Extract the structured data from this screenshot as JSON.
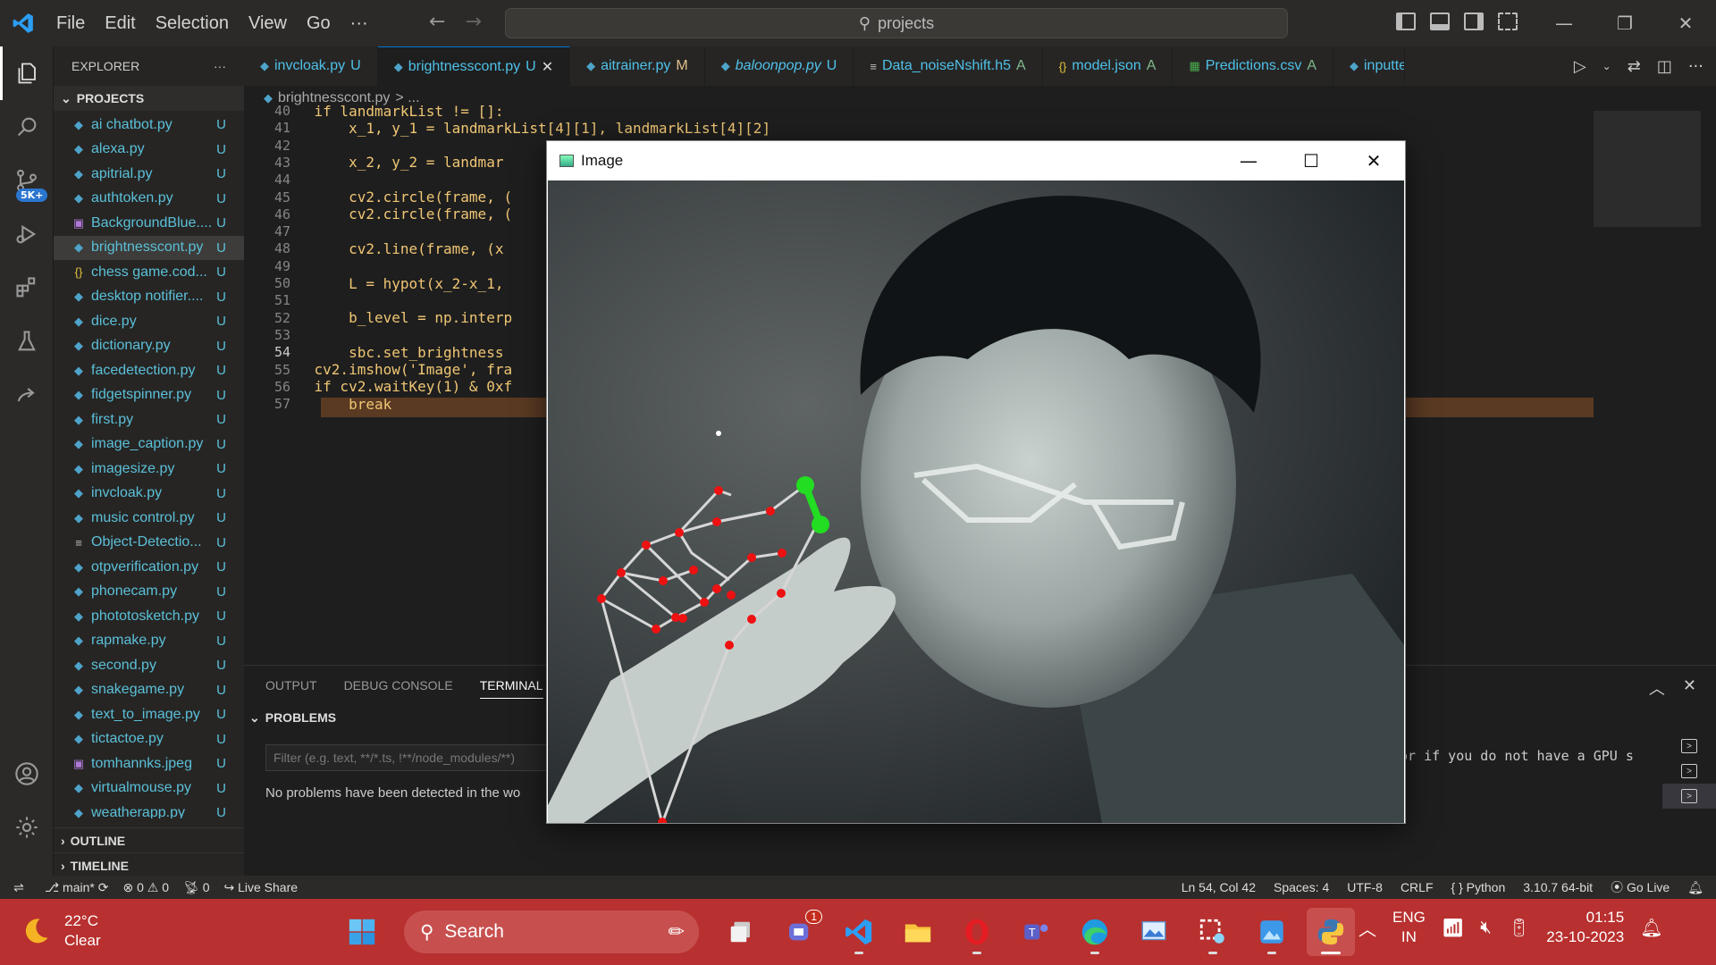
{
  "menu": [
    "File",
    "Edit",
    "Selection",
    "View",
    "Go",
    "···"
  ],
  "command_center": {
    "text": "projects"
  },
  "explorer": {
    "title": "EXPLORER",
    "more": "···",
    "section": "PROJECTS",
    "files": [
      {
        "name": "ai chatbot.py",
        "status": "U",
        "icon": "python-icon"
      },
      {
        "name": "alexa.py",
        "status": "U",
        "icon": "python-icon"
      },
      {
        "name": "apitrial.py",
        "status": "U",
        "icon": "python-icon"
      },
      {
        "name": "authtoken.py",
        "status": "U",
        "icon": "python-icon"
      },
      {
        "name": "BackgroundBlue....",
        "status": "U",
        "icon": "image-icon"
      },
      {
        "name": "brightnesscont.py",
        "status": "U",
        "icon": "python-icon",
        "selected": true
      },
      {
        "name": "chess game.cod...",
        "status": "U",
        "icon": "json-icon"
      },
      {
        "name": "desktop notifier....",
        "status": "U",
        "icon": "python-icon"
      },
      {
        "name": "dice.py",
        "status": "U",
        "icon": "python-icon"
      },
      {
        "name": "dictionary.py",
        "status": "U",
        "icon": "python-icon"
      },
      {
        "name": "facedetection.py",
        "status": "U",
        "icon": "python-icon"
      },
      {
        "name": "fidgetspinner.py",
        "status": "U",
        "icon": "python-icon"
      },
      {
        "name": "first.py",
        "status": "U",
        "icon": "python-icon"
      },
      {
        "name": "image_caption.py",
        "status": "U",
        "icon": "python-icon"
      },
      {
        "name": "imagesize.py",
        "status": "U",
        "icon": "python-icon"
      },
      {
        "name": "invcloak.py",
        "status": "U",
        "icon": "python-icon"
      },
      {
        "name": "music control.py",
        "status": "U",
        "icon": "python-icon"
      },
      {
        "name": "Object-Detectio...",
        "status": "U",
        "icon": "text-icon"
      },
      {
        "name": "otpverification.py",
        "status": "U",
        "icon": "python-icon"
      },
      {
        "name": "phonecam.py",
        "status": "U",
        "icon": "python-icon"
      },
      {
        "name": "phototosketch.py",
        "status": "U",
        "icon": "python-icon"
      },
      {
        "name": "rapmake.py",
        "status": "U",
        "icon": "python-icon"
      },
      {
        "name": "second.py",
        "status": "U",
        "icon": "python-icon"
      },
      {
        "name": "snakegame.py",
        "status": "U",
        "icon": "python-icon"
      },
      {
        "name": "text_to_image.py",
        "status": "U",
        "icon": "python-icon"
      },
      {
        "name": "tictactoe.py",
        "status": "U",
        "icon": "python-icon"
      },
      {
        "name": "tomhannks.jpeg",
        "status": "U",
        "icon": "image-icon"
      },
      {
        "name": "virtualmouse.py",
        "status": "U",
        "icon": "python-icon"
      },
      {
        "name": "weatherapp.py",
        "status": "U",
        "icon": "python-icon"
      }
    ],
    "outline": "OUTLINE",
    "timeline": "TIMELINE"
  },
  "tabs": [
    {
      "name": "invcloak.py",
      "status": "U",
      "icon": "python-icon"
    },
    {
      "name": "brightnesscont.py",
      "status": "U",
      "icon": "python-icon",
      "active": true
    },
    {
      "name": "aitrainer.py",
      "status": "M",
      "icon": "python-icon"
    },
    {
      "name": "baloonpop.py",
      "status": "U",
      "icon": "python-icon",
      "italic": true
    },
    {
      "name": "Data_noiseNshift.h5",
      "status": "A",
      "icon": "text-icon"
    },
    {
      "name": "model.json",
      "status": "A",
      "icon": "json-icon"
    },
    {
      "name": "Predictions.csv",
      "status": "A",
      "icon": "csv-icon"
    },
    {
      "name": "inputtе",
      "status": "",
      "icon": "python-icon"
    }
  ],
  "breadcrumb": {
    "file": "brightnesscont.py",
    "sep": "> ..."
  },
  "code_lines": [
    {
      "n": "40",
      "text": "    if landmarkList != []:"
    },
    {
      "n": "41",
      "text": "        x_1, y_1 = landmarkList[4][1], landmarkList[4][2]"
    },
    {
      "n": "42",
      "text": ""
    },
    {
      "n": "43",
      "text": "        x_2, y_2 = landmar"
    },
    {
      "n": "44",
      "text": ""
    },
    {
      "n": "45",
      "text": "        cv2.circle(frame, ("
    },
    {
      "n": "46",
      "text": "        cv2.circle(frame, ("
    },
    {
      "n": "47",
      "text": ""
    },
    {
      "n": "48",
      "text": "        cv2.line(frame, (x"
    },
    {
      "n": "49",
      "text": ""
    },
    {
      "n": "50",
      "text": "        L = hypot(x_2-x_1,"
    },
    {
      "n": "51",
      "text": ""
    },
    {
      "n": "52",
      "text": "        b_level = np.interp"
    },
    {
      "n": "53",
      "text": ""
    },
    {
      "n": "54",
      "text": "        sbc.set_brightness"
    },
    {
      "n": "55",
      "text": "    cv2.imshow('Image', fra"
    },
    {
      "n": "56",
      "text": "    if cv2.waitKey(1) & 0xf"
    },
    {
      "n": "57",
      "text": "        break"
    }
  ],
  "panel": {
    "tabs": [
      "OUTPUT",
      "DEBUG CONSOLE",
      "TERMINAL"
    ],
    "problems": "PROBLEMS",
    "filter_placeholder": "Filter (e.g. text, **/*.ts, !**/node_modules/**)",
    "no_problems": "No problems have been detected in the wo",
    "terminal_text": "or if you do not have a GPU s"
  },
  "image_window": {
    "title": "Image"
  },
  "status": {
    "branch": "main*",
    "errors": "0",
    "warnings": "0",
    "ports": "0",
    "live_share": "Live Share",
    "cursor": "Ln 54, Col 42",
    "spaces": "Spaces: 4",
    "encoding": "UTF-8",
    "eol": "CRLF",
    "language": "Python",
    "interpreter": "3.10.7 64-bit",
    "go_live": "Go Live"
  },
  "taskbar": {
    "temp": "22°C",
    "condition": "Clear",
    "search": "Search",
    "lang1": "ENG",
    "lang2": "IN",
    "time": "01:15",
    "date": "23-10-2023",
    "teams_badge": "1"
  },
  "activity_badge": "5K+",
  "colors": {
    "accent": "#0078d4",
    "taskbar": "#b8302f",
    "hand_joint": "#ee1111",
    "pinch_line": "#22dd22"
  }
}
